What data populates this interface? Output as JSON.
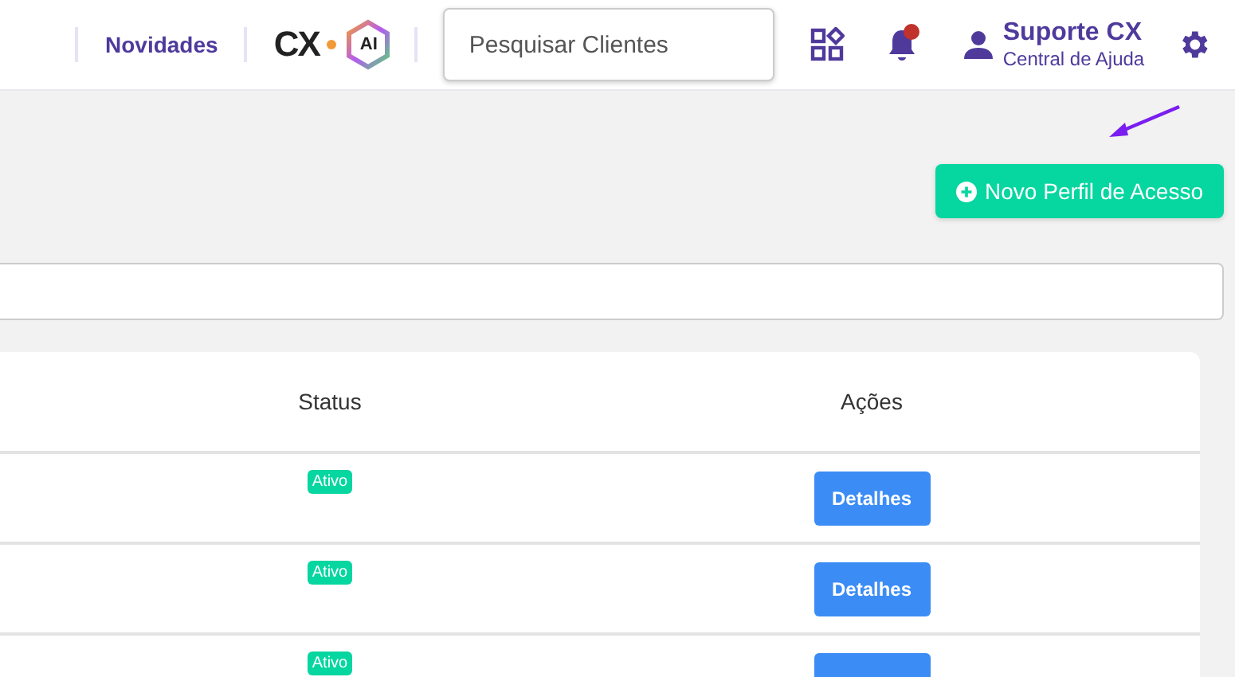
{
  "header": {
    "news_link": "Novidades",
    "logo": {
      "text": "CX",
      "badge": "AI"
    },
    "search": {
      "placeholder": "Pesquisar Clientes"
    },
    "notifications": {
      "unread": true
    },
    "user": {
      "name": "Suporte CX",
      "subtitle": "Central de Ajuda"
    }
  },
  "toolbar": {
    "new_button": "Novo Perfil de Acesso",
    "annotation_arrow": true
  },
  "table": {
    "columns": [
      "Status",
      "Ações"
    ],
    "rows": [
      {
        "status": "Ativo",
        "action": "Detalhes"
      },
      {
        "status": "Ativo",
        "action": "Detalhes"
      },
      {
        "status": "Ativo"
      }
    ]
  }
}
